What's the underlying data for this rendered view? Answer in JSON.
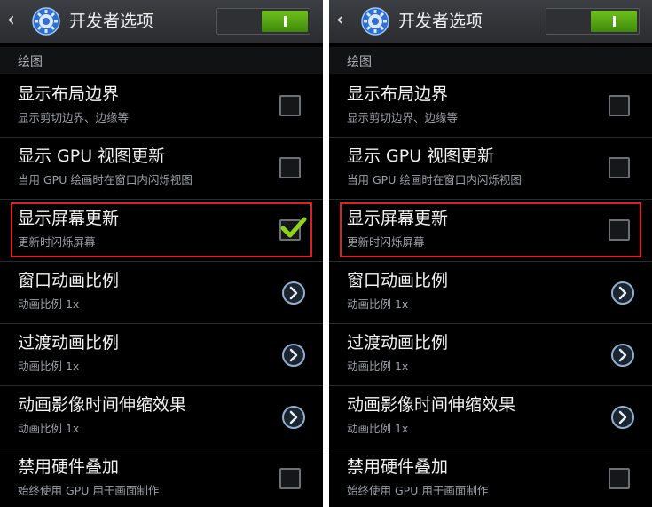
{
  "panels": [
    {
      "title": "开发者选项",
      "section": "绘图",
      "rows": [
        {
          "title": "显示布局边界",
          "sub": "显示剪切边界、边缘等",
          "control": "checkbox",
          "checked": false
        },
        {
          "title": "显示 GPU 视图更新",
          "sub": "当用 GPU 绘画时在窗口内闪烁视图",
          "control": "checkbox",
          "checked": false
        },
        {
          "title": "显示屏幕更新",
          "sub": "更新时闪烁屏幕",
          "control": "checkbox",
          "checked": true
        },
        {
          "title": "窗口动画比例",
          "sub": "动画比例 1x",
          "control": "chevron"
        },
        {
          "title": "过渡动画比例",
          "sub": "动画比例 1x",
          "control": "chevron"
        },
        {
          "title": "动画影像时间伸缩效果",
          "sub": "动画比例 1x",
          "control": "chevron"
        },
        {
          "title": "禁用硬件叠加",
          "sub": "始终使用 GPU 用于画面制作",
          "control": "checkbox",
          "checked": false
        }
      ]
    },
    {
      "title": "开发者选项",
      "section": "绘图",
      "rows": [
        {
          "title": "显示布局边界",
          "sub": "显示剪切边界、边缘等",
          "control": "checkbox",
          "checked": false
        },
        {
          "title": "显示 GPU 视图更新",
          "sub": "当用 GPU 绘画时在窗口内闪烁视图",
          "control": "checkbox",
          "checked": false
        },
        {
          "title": "显示屏幕更新",
          "sub": "更新时闪烁屏幕",
          "control": "checkbox",
          "checked": false
        },
        {
          "title": "窗口动画比例",
          "sub": "动画比例 1x",
          "control": "chevron"
        },
        {
          "title": "过渡动画比例",
          "sub": "动画比例 1x",
          "control": "chevron"
        },
        {
          "title": "动画影像时间伸缩效果",
          "sub": "动画比例 1x",
          "control": "chevron"
        },
        {
          "title": "禁用硬件叠加",
          "sub": "始终使用 GPU 用于画面制作",
          "control": "checkbox",
          "checked": false
        }
      ]
    }
  ],
  "colors": {
    "accent": "#6ec01c",
    "highlight": "#e21e1e",
    "background": "#000000"
  },
  "icons": {
    "back": "chevron-left-icon",
    "settings": "gear-icon",
    "check": "check-icon",
    "more": "chevron-right-circle-icon"
  }
}
